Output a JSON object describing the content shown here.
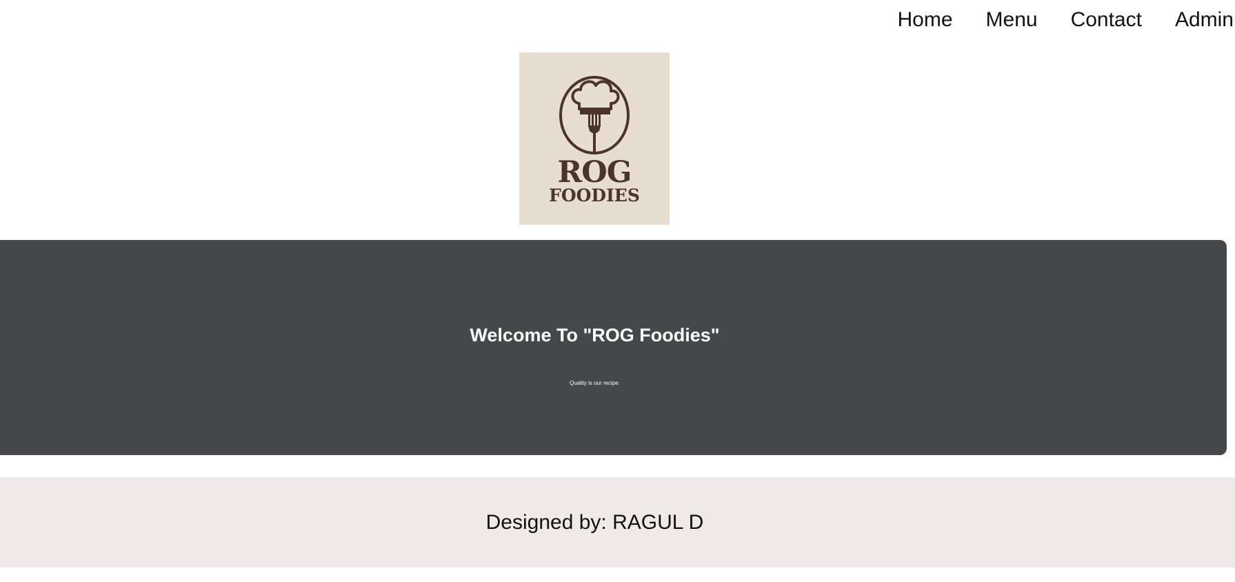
{
  "nav": {
    "items": [
      {
        "label": "Home"
      },
      {
        "label": "Menu"
      },
      {
        "label": "Contact"
      },
      {
        "label": "Admin"
      }
    ]
  },
  "logo": {
    "line1": "ROG",
    "line2": "FOODIES",
    "background_color": "#e7ddd0",
    "ink_color": "#4a3528",
    "icons": [
      "chef-hat-icon",
      "fork-icon"
    ]
  },
  "hero": {
    "title": "Welcome To \"ROG Foodies\"",
    "subtitle": "Quality is our recipe.",
    "background_color": "#464749"
  },
  "footer": {
    "text": "Designed by: RAGUL D",
    "background_color": "#efe9e9"
  }
}
